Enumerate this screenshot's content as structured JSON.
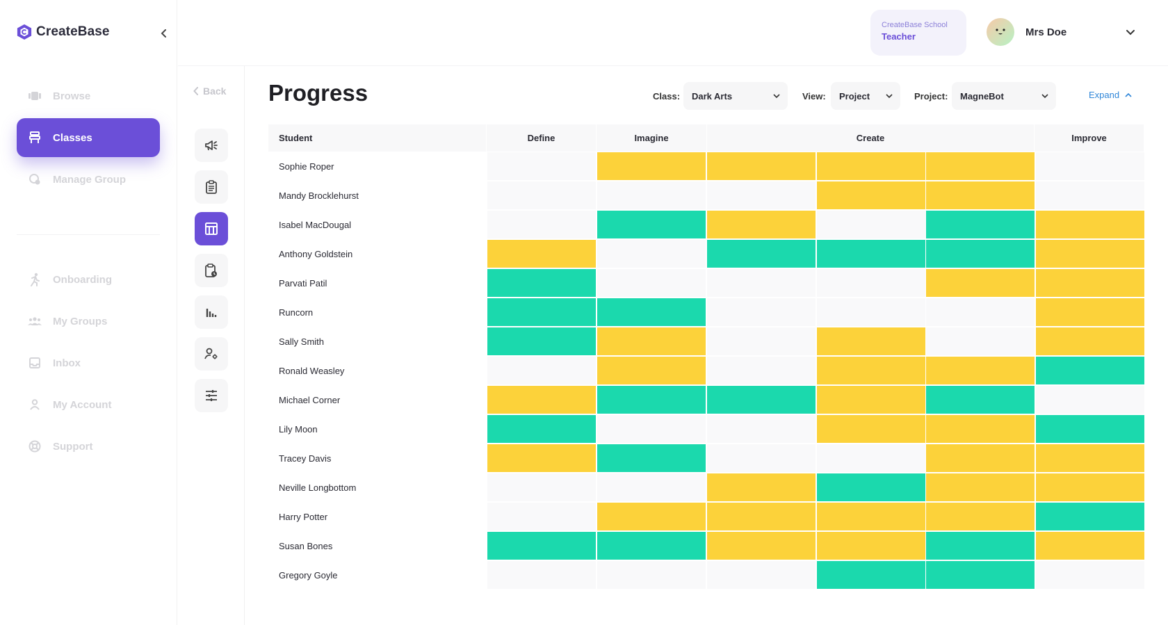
{
  "app": {
    "name": "CreateBase"
  },
  "sidebar": {
    "items": [
      {
        "label": "Browse",
        "icon": "browse-icon",
        "active": false
      },
      {
        "label": "Classes",
        "icon": "classes-icon",
        "active": true
      },
      {
        "label": "Manage Group",
        "icon": "manage-group-icon",
        "active": false
      },
      {
        "label": "Onboarding",
        "icon": "onboarding-icon",
        "active": false
      },
      {
        "label": "My Groups",
        "icon": "groups-icon",
        "active": false
      },
      {
        "label": "Inbox",
        "icon": "inbox-icon",
        "active": false
      },
      {
        "label": "My Account",
        "icon": "account-icon",
        "active": false
      },
      {
        "label": "Support",
        "icon": "support-icon",
        "active": false
      }
    ]
  },
  "rail": {
    "back_label": "Back",
    "buttons": [
      {
        "icon": "megaphone-icon",
        "active": false
      },
      {
        "icon": "clipboard-icon",
        "active": false
      },
      {
        "icon": "table-icon",
        "active": true
      },
      {
        "icon": "clipboard-clock-icon",
        "active": false
      },
      {
        "icon": "bar-chart-icon",
        "active": false
      },
      {
        "icon": "user-settings-icon",
        "active": false
      },
      {
        "icon": "sliders-icon",
        "active": false
      }
    ]
  },
  "header": {
    "school": "CreateBase School",
    "role": "Teacher",
    "user_name": "Mrs Doe"
  },
  "main": {
    "title": "Progress",
    "filters": {
      "class_label": "Class:",
      "class_value": "Dark Arts",
      "view_label": "View:",
      "view_value": "Project",
      "project_label": "Project:",
      "project_value": "MagneBot"
    },
    "expand_label": "Expand"
  },
  "table": {
    "headers": {
      "student": "Student",
      "stages": [
        "Define",
        "Imagine",
        "Create",
        "Improve"
      ]
    },
    "legend_colors": {
      "blank": "#f9f9fa",
      "yellow": "#fcd23a",
      "green": "#1bd9ad"
    },
    "rows": [
      {
        "name": "Sophie Roper",
        "cells": [
          "",
          "y",
          "y",
          "y",
          "y",
          ""
        ]
      },
      {
        "name": "Mandy Brocklehurst",
        "cells": [
          "",
          "",
          "",
          "y",
          "y",
          ""
        ]
      },
      {
        "name": "Isabel MacDougal",
        "cells": [
          "",
          "g",
          "y",
          "",
          "g",
          "y"
        ]
      },
      {
        "name": "Anthony Goldstein",
        "cells": [
          "y",
          "",
          "g",
          "g",
          "g",
          "y"
        ]
      },
      {
        "name": "Parvati Patil",
        "cells": [
          "g",
          "",
          "",
          "",
          "y",
          "y"
        ]
      },
      {
        "name": "Runcorn",
        "cells": [
          "g",
          "g",
          "",
          "",
          "",
          "y"
        ]
      },
      {
        "name": "Sally Smith",
        "cells": [
          "g",
          "y",
          "",
          "y",
          "",
          "y"
        ]
      },
      {
        "name": "Ronald Weasley",
        "cells": [
          "",
          "y",
          "",
          "y",
          "y",
          "g"
        ]
      },
      {
        "name": "Michael Corner",
        "cells": [
          "y",
          "g",
          "g",
          "y",
          "g",
          ""
        ]
      },
      {
        "name": "Lily Moon",
        "cells": [
          "g",
          "",
          "",
          "y",
          "y",
          "g"
        ]
      },
      {
        "name": "Tracey Davis",
        "cells": [
          "y",
          "g",
          "",
          "",
          "y",
          "y"
        ]
      },
      {
        "name": "Neville Longbottom",
        "cells": [
          "",
          "",
          "y",
          "g",
          "y",
          "y"
        ]
      },
      {
        "name": "Harry Potter",
        "cells": [
          "",
          "y",
          "y",
          "y",
          "y",
          "g"
        ]
      },
      {
        "name": "Susan Bones",
        "cells": [
          "g",
          "g",
          "y",
          "y",
          "g",
          "y"
        ]
      },
      {
        "name": "Gregory Goyle",
        "cells": [
          "",
          "",
          "",
          "g",
          "g",
          ""
        ]
      }
    ]
  }
}
